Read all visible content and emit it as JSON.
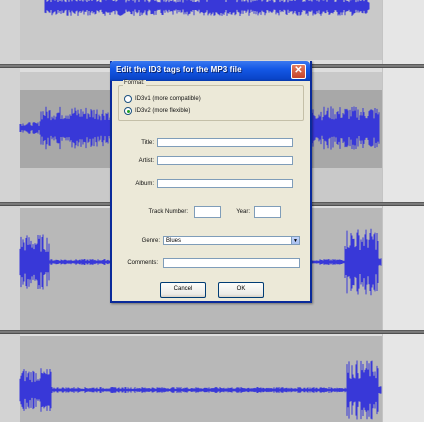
{
  "dialog": {
    "title": "Edit the ID3 tags for the MP3 file",
    "close_glyph": "✕",
    "format": {
      "label": "Format:",
      "options": [
        {
          "label": "ID3v1 (more compatible)",
          "selected": false
        },
        {
          "label": "ID3v2 (more flexible)",
          "selected": true
        }
      ]
    },
    "fields": {
      "title_label": "Title:",
      "title_value": "",
      "artist_label": "Artist:",
      "artist_value": "",
      "album_label": "Album:",
      "album_value": "",
      "track_label": "Track Number:",
      "track_value": "",
      "year_label": "Year:",
      "year_value": "",
      "genre_label": "Genre:",
      "genre_value": "Blues",
      "comments_label": "Comments:",
      "comments_value": ""
    },
    "buttons": {
      "cancel": "Cancel",
      "ok": "OK"
    }
  },
  "colors": {
    "waveform": "#3838d8",
    "titlebar": "#1458e6"
  }
}
